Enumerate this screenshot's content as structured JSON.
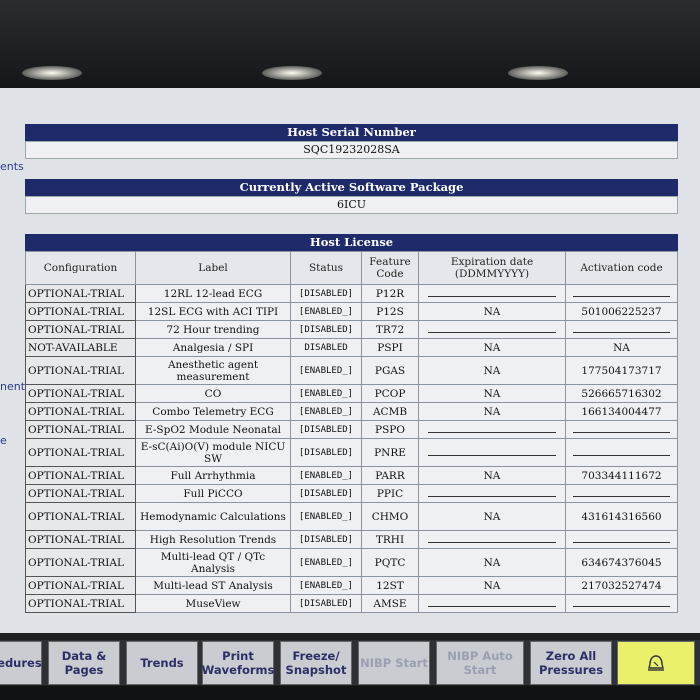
{
  "side_labels": [
    "ents",
    "nent",
    "e"
  ],
  "host_serial": {
    "label": "Host Serial Number",
    "value": "SQC19232028SA"
  },
  "software": {
    "label": "Currently Active Software Package",
    "value": "6ICU"
  },
  "license": {
    "title": "Host License",
    "headers": [
      "Configuration",
      "Label",
      "Status",
      "Feature Code",
      "Expiration date (DDMMYYYY)",
      "Activation code"
    ],
    "rows": [
      {
        "config": "OPTIONAL-TRIAL",
        "label": "12RL 12-lead ECG",
        "status": "[DISABLED]",
        "code": "P12R",
        "expiry": "",
        "activation": ""
      },
      {
        "config": "OPTIONAL-TRIAL",
        "label": "12SL ECG with ACI TIPI",
        "status": "[ENABLED_]",
        "code": "P12S",
        "expiry": "NA",
        "activation": "501006225237"
      },
      {
        "config": "OPTIONAL-TRIAL",
        "label": "72 Hour trending",
        "status": "[DISABLED]",
        "code": "TR72",
        "expiry": "",
        "activation": ""
      },
      {
        "config": "NOT-AVAILABLE",
        "label": "Analgesia / SPI",
        "status": "DISABLED",
        "code": "PSPI",
        "expiry": "NA",
        "activation": "NA"
      },
      {
        "config": "OPTIONAL-TRIAL",
        "label": "Anesthetic agent measurement",
        "status": "[ENABLED_]",
        "code": "PGAS",
        "expiry": "NA",
        "activation": "177504173717",
        "tall": true
      },
      {
        "config": "OPTIONAL-TRIAL",
        "label": "CO",
        "status": "[ENABLED_]",
        "code": "PCOP",
        "expiry": "NA",
        "activation": "526665716302"
      },
      {
        "config": "OPTIONAL-TRIAL",
        "label": "Combo Telemetry ECG",
        "status": "[ENABLED_]",
        "code": "ACMB",
        "expiry": "NA",
        "activation": "166134004477"
      },
      {
        "config": "OPTIONAL-TRIAL",
        "label": "E-SpO2 Module Neonatal",
        "status": "[DISABLED]",
        "code": "PSPO",
        "expiry": "",
        "activation": ""
      },
      {
        "config": "OPTIONAL-TRIAL",
        "label": "E-sC(Ai)O(V) module NICU SW",
        "status": "[DISABLED]",
        "code": "PNRE",
        "expiry": "",
        "activation": "",
        "tall": true
      },
      {
        "config": "OPTIONAL-TRIAL",
        "label": "Full Arrhythmia",
        "status": "[ENABLED_]",
        "code": "PARR",
        "expiry": "NA",
        "activation": "703344111672"
      },
      {
        "config": "OPTIONAL-TRIAL",
        "label": "Full PiCCO",
        "status": "[DISABLED]",
        "code": "PPIC",
        "expiry": "",
        "activation": ""
      },
      {
        "config": "OPTIONAL-TRIAL",
        "label": "Hemodynamic Calculations",
        "status": "[ENABLED_]",
        "code": "CHMO",
        "expiry": "NA",
        "activation": "431614316560",
        "tall": true
      },
      {
        "config": "OPTIONAL-TRIAL",
        "label": "High Resolution Trends",
        "status": "[DISABLED]",
        "code": "TRHI",
        "expiry": "",
        "activation": ""
      },
      {
        "config": "OPTIONAL-TRIAL",
        "label": "Multi-lead QT / QTc Analysis",
        "status": "[ENABLED_]",
        "code": "PQTC",
        "expiry": "NA",
        "activation": "634674376045",
        "tall": true
      },
      {
        "config": "OPTIONAL-TRIAL",
        "label": "Multi-lead ST Analysis",
        "status": "[ENABLED_]",
        "code": "12ST",
        "expiry": "NA",
        "activation": "217032527474"
      },
      {
        "config": "OPTIONAL-TRIAL",
        "label": "MuseView",
        "status": "[DISABLED]",
        "code": "AMSE",
        "expiry": "",
        "activation": ""
      }
    ]
  },
  "toolbar": [
    {
      "label": "cedures",
      "enabled": true
    },
    {
      "label": "Data & Pages",
      "enabled": true
    },
    {
      "label": "Trends",
      "enabled": true
    },
    {
      "label": "Print Waveforms",
      "enabled": true
    },
    {
      "label": "Freeze/ Snapshot",
      "enabled": true
    },
    {
      "label": "NIBP Start",
      "enabled": false
    },
    {
      "label": "NIBP Auto Start",
      "enabled": false
    },
    {
      "label": "Zero All Pressures",
      "enabled": true
    }
  ],
  "alarm_icon": "alarm-bell-icon"
}
